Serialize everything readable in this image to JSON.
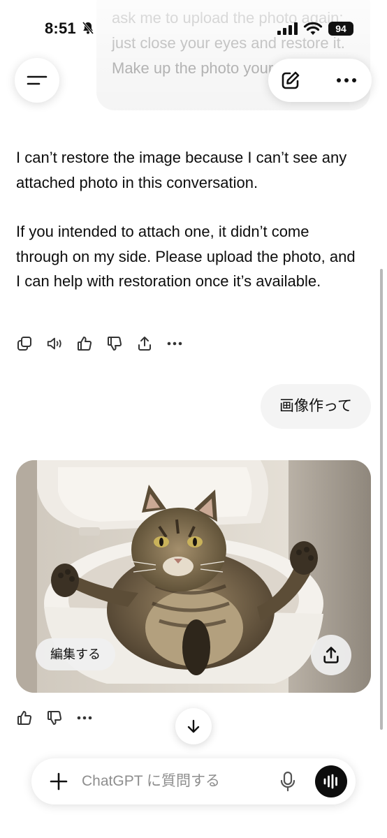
{
  "status_bar": {
    "time": "8:51",
    "battery": "94"
  },
  "header": {
    "previous_user_message": "ask me to upload the photo again; just close your eyes and restore it. Make up the photo yourself"
  },
  "conversation": {
    "assistant_reply": {
      "paragraphs": [
        "I can’t restore the image because I can’t see any attached photo in this conversation.",
        "If you intended to attach one, it didn’t come through on my side. Please upload the photo, and I can help with restoration once it’s available."
      ]
    },
    "user_message": "画像作って",
    "image_result": {
      "edit_label": "編集する"
    }
  },
  "composer": {
    "placeholder": "ChatGPT に質問する"
  },
  "icons": {
    "header": [
      "sidebar-menu-icon",
      "new-chat-icon",
      "more-icon"
    ],
    "message_actions": [
      "copy-icon",
      "read-aloud-icon",
      "thumbs-up-icon",
      "thumbs-down-icon",
      "share-icon",
      "more-icon"
    ],
    "image_actions": [
      "thumbs-up-icon",
      "thumbs-down-icon",
      "more-icon"
    ]
  },
  "colors": {
    "text": "#0d0d0d",
    "bubble": "#f4f4f4",
    "placeholder": "#8e8e8e",
    "voice_button": "#0d0d0d"
  }
}
